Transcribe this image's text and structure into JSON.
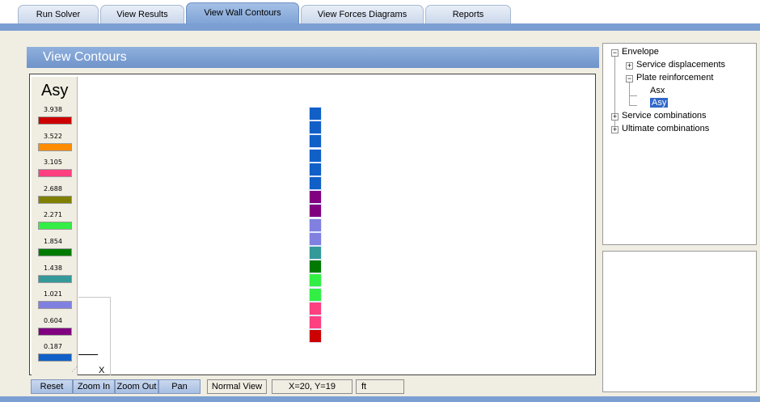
{
  "tabs": [
    {
      "label": "Run Solver",
      "active": false
    },
    {
      "label": "View Results",
      "active": false
    },
    {
      "label": "View Wall Contours",
      "active": true
    },
    {
      "label": "View Forces Diagrams",
      "active": false
    },
    {
      "label": "Reports",
      "active": false
    }
  ],
  "panel": {
    "title": "View Contours"
  },
  "legend": {
    "title": "Asy",
    "entries": [
      {
        "value": "3.938",
        "color": "#cc0000"
      },
      {
        "value": "3.522",
        "color": "#ff8c00"
      },
      {
        "value": "3.105",
        "color": "#ff4080"
      },
      {
        "value": "2.688",
        "color": "#808000"
      },
      {
        "value": "2.271",
        "color": "#33ee44"
      },
      {
        "value": "1.854",
        "color": "#007a00"
      },
      {
        "value": "1.438",
        "color": "#339999"
      },
      {
        "value": "1.021",
        "color": "#8080e0"
      },
      {
        "value": "0.604",
        "color": "#800080"
      },
      {
        "value": "0.187",
        "color": "#1060c8"
      }
    ]
  },
  "wall_cells": [
    "#1060c8",
    "#1060c8",
    "#1060c8",
    "#1060c8",
    "#1060c8",
    "#1060c8",
    "#800080",
    "#800080",
    "#8080e0",
    "#8080e0",
    "#339999",
    "#007a00",
    "#33ee44",
    "#33ee44",
    "#ff4080",
    "#ff4080",
    "#cc0000"
  ],
  "axis": {
    "x_label": "X"
  },
  "toolbar": {
    "reset": "Reset",
    "zoom_in": "Zoom In",
    "zoom_out": "Zoom Out",
    "pan": "Pan",
    "view_mode": "Normal View",
    "coords": "X=20, Y=19",
    "units": "ft"
  },
  "tree": {
    "root": "Envelope",
    "service_displacements": "Service displacements",
    "plate_reinforcement": "Plate reinforcement",
    "asx": "Asx",
    "asy": "Asy",
    "service_combinations": "Service combinations",
    "ultimate_combinations": "Ultimate combinations",
    "expanded_glyph": "−",
    "collapsed_glyph": "+"
  }
}
